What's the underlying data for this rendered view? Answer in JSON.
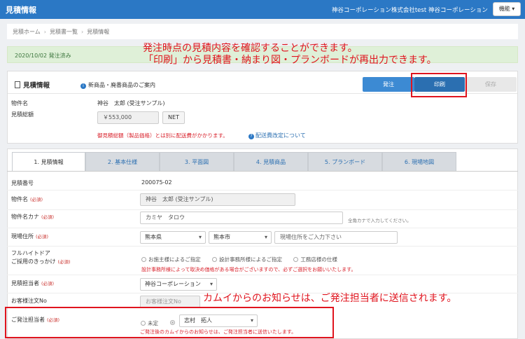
{
  "app": {
    "title": "見積情報"
  },
  "header": {
    "company_full": "神谷コーポレーション株式会社test",
    "company_short": "神谷コーポレーション",
    "menu_label": "機能"
  },
  "breadcrumb": [
    "見積ホーム",
    "見積書一覧",
    "見積情報"
  ],
  "status_bar": {
    "text": "2020/10/02 発注済み"
  },
  "overlay": {
    "line1": "発注時点の見積内容を確認することができます。",
    "line2": "「印刷」から見積書・納まり図・プランボードが再出力できます。",
    "line3": "カムイからのお知らせは、ご発注担当者に送信されます。"
  },
  "quote_panel": {
    "title": "見積情報",
    "info_link": "新商品・廃番商品のご案内",
    "buttons": {
      "order": "発注",
      "print": "印刷",
      "save": "保存"
    },
    "property_label": "物件名",
    "property_value": "神谷　太郎 (受注サンプル)",
    "total_label": "見積総額",
    "total_value": "￥553,000",
    "net_label": "NET",
    "note_red": "御見積総額（製品価格）とは別に配送費がかかります。",
    "note_link": "配送費改定について"
  },
  "tabs": [
    "1. 見積情報",
    "2. 基本仕様",
    "3. 平面図",
    "4. 見積商品",
    "5. プランボード",
    "6. 現場地図"
  ],
  "form": {
    "required_label": "(必須)",
    "quote_no_label": "見積番号",
    "quote_no_value": "200075-02",
    "property_label": "物件名",
    "property_value": "神谷　太郎 (受注サンプル)",
    "kana_label": "物件名カナ",
    "kana_value": "カミヤ　タロウ",
    "kana_note": "全角カナで入力してください。",
    "site_label": "現場住所",
    "prefecture": "熊本県",
    "city": "熊本市",
    "address_placeholder": "現場住所をご入力下さい",
    "fullheight_label_1": "フルハイトドア",
    "fullheight_label_2": "ご採用のきっかけ",
    "fullheight_options": [
      "お施主様によるご指定",
      "設計事務所様によるご指定",
      "工務店様の仕様"
    ],
    "fullheight_note": "設計事務所様によって取決め価格がある場合がございますので、必ずご選択をお願いいたします。",
    "staff_label": "見積担当者",
    "staff_value": "神谷コーポレーション",
    "customer_order_label": "お客様注文No",
    "customer_order_placeholder": "お客様注文No",
    "assignee_label": "ご発注担当者",
    "assignee_option_undecided": "未定",
    "assignee_value": "志村　拓人",
    "assignee_note": "ご発注後のカムイからのお知らせは、ご発注担当者に送信いたします。"
  }
}
